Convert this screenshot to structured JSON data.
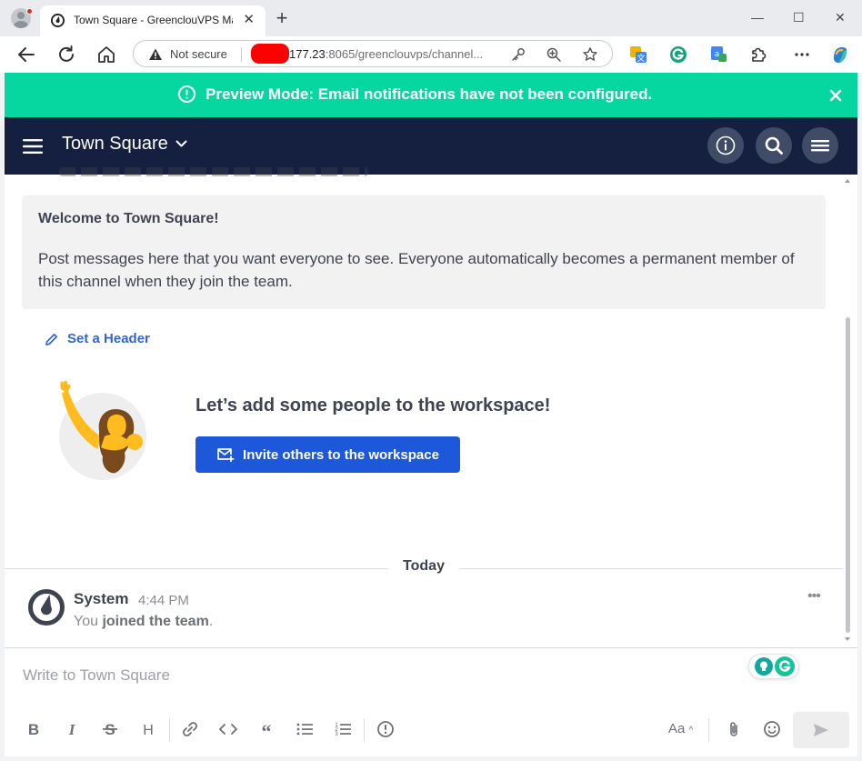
{
  "browser": {
    "tab_title": "Town Square - GreenclouVPS Mat",
    "tab_close": "✕",
    "new_tab": "+",
    "window_controls": {
      "minimize": "—",
      "maximize": "☐",
      "close": "✕"
    },
    "address": {
      "security_label": "Not secure",
      "url_host": "177.23",
      "url_rest": ":8065/greenclouvps/channel..."
    }
  },
  "banner": {
    "text": "Preview Mode: Email notifications have not been configured."
  },
  "header": {
    "channel_name": "Town Square"
  },
  "intro": {
    "welcome_title": "Welcome to Town Square!",
    "welcome_body": "Post messages here that you want everyone to see. Everyone automatically becomes a permanent member of this channel when they join the team.",
    "set_header_label": "Set a Header",
    "add_people_title": "Let’s add some people to the workspace!",
    "invite_button_label": "Invite others to the workspace"
  },
  "separator": {
    "label": "Today"
  },
  "posts": [
    {
      "author": "System",
      "time": "4:44 PM",
      "text_prefix": "You ",
      "text_bold": "joined the team",
      "text_suffix": ".",
      "more_label": "•••"
    }
  ],
  "composer": {
    "placeholder": "Write to Town Square",
    "formatting_toggle_label": "Aa",
    "formatting": [
      "bold",
      "italic",
      "strikethrough",
      "heading",
      "link",
      "code",
      "quote",
      "bulleted-list",
      "numbered-list",
      "emoji-info"
    ]
  },
  "colors": {
    "banner_bg": "#06d6a0",
    "header_bg": "#152040",
    "button_primary": "#1c58d9",
    "link": "#3366cc",
    "text": "#3f4350",
    "redaction": "#ff0000"
  }
}
